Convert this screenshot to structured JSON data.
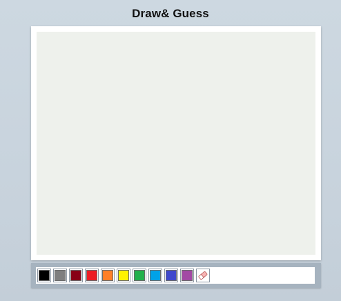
{
  "header": {
    "title": "Draw& Guess"
  },
  "palette": {
    "colors": [
      {
        "name": "black",
        "hex": "#000000"
      },
      {
        "name": "gray",
        "hex": "#7f7f7f"
      },
      {
        "name": "dark-red",
        "hex": "#880015"
      },
      {
        "name": "red",
        "hex": "#ed1c24"
      },
      {
        "name": "orange",
        "hex": "#ff7f27"
      },
      {
        "name": "yellow",
        "hex": "#fff200"
      },
      {
        "name": "green",
        "hex": "#22b14c"
      },
      {
        "name": "blue",
        "hex": "#00a2e8"
      },
      {
        "name": "indigo",
        "hex": "#3f48cc"
      },
      {
        "name": "purple",
        "hex": "#a349a4"
      }
    ],
    "eraser_icon": "eraser-icon"
  },
  "theme": {
    "background": "#cad5df",
    "canvas": "#eef1ec",
    "toolbar": "#a6b3bf"
  }
}
